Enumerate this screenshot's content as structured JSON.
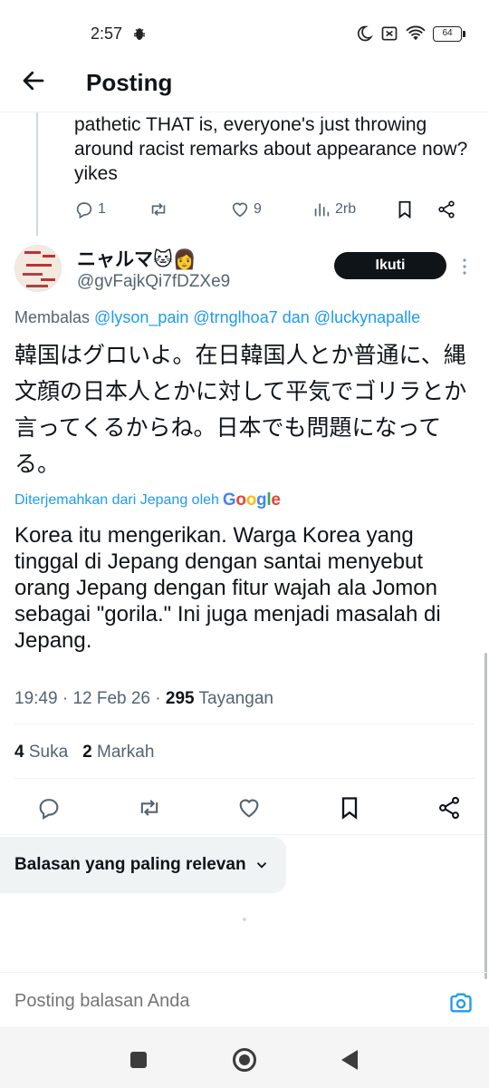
{
  "status": {
    "time": "2:57",
    "battery": "64",
    "icons": [
      "bug-icon",
      "moon-icon",
      "sim-off-icon",
      "wifi-icon",
      "battery-icon"
    ]
  },
  "header": {
    "title": "Posting"
  },
  "previous_reply": {
    "text": "pathetic THAT is, everyone's just throwing around racist remarks about appearance now? yikes",
    "replies": "1",
    "retweets": "",
    "likes": "9",
    "views": "2rb"
  },
  "post": {
    "author_name": "ニャルマ🐱👩",
    "author_handle": "@gvFajkQi7fDZXe9",
    "follow_label": "Ikuti",
    "reply_prefix": "Membalas",
    "reply_mentions": "@lyson_pain @trnglhoa7",
    "reply_and": "dan",
    "reply_last_mention": "@luckynapalle",
    "original_text": "韓国はグロいよ。在日韓国人とか普通に、縄文顔の日本人とかに対して平気でゴリラとか言ってくるからね。日本でも問題になってる。",
    "translated_by": "Diterjemahkan dari Jepang oleh",
    "translated_engine": "Google",
    "translated_text": "Korea itu mengerikan. Warga Korea yang tinggal di Jepang dengan santai menyebut orang Jepang dengan fitur wajah ala Jomon sebagai \"gorila.\" Ini juga menjadi masalah di Jepang.",
    "time": "19:49",
    "date": "12 Feb 26",
    "views_count": "295",
    "views_label": "Tayangan",
    "likes_count": "4",
    "likes_label": "Suka",
    "bookmarks_count": "2",
    "bookmarks_label": "Markah"
  },
  "sort": {
    "label": "Balasan yang paling relevan"
  },
  "reply_bar": {
    "placeholder": "Posting balasan Anda"
  },
  "colors": {
    "accent": "#1d9bf0",
    "text": "#0f1419",
    "secondary": "#536471"
  }
}
